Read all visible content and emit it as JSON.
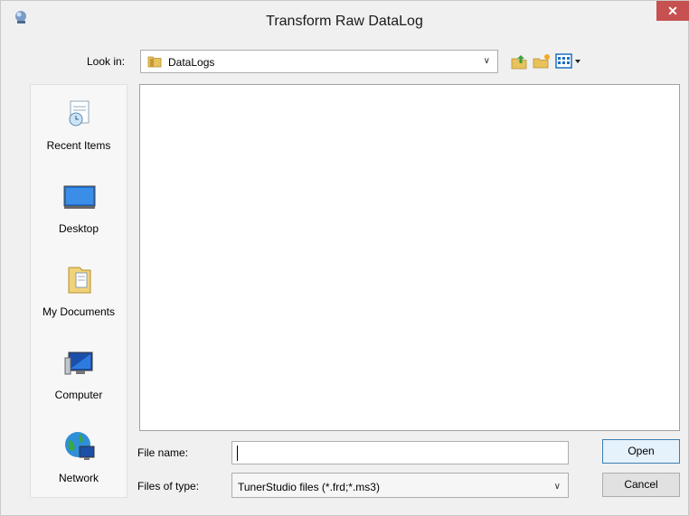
{
  "window": {
    "title": "Transform Raw DataLog",
    "close_glyph": "✕"
  },
  "lookin": {
    "label": "Look in:",
    "value": "DataLogs"
  },
  "toolbar": {
    "icons": [
      "up-folder-icon",
      "new-folder-icon",
      "view-menu-icon"
    ]
  },
  "places": [
    {
      "label": "Recent Items",
      "icon": "recent-items-icon"
    },
    {
      "label": "Desktop",
      "icon": "desktop-icon"
    },
    {
      "label": "My Documents",
      "icon": "my-documents-icon"
    },
    {
      "label": "Computer",
      "icon": "computer-icon"
    },
    {
      "label": "Network",
      "icon": "network-icon"
    }
  ],
  "filename": {
    "label": "File name:",
    "value": ""
  },
  "filetype": {
    "label": "Files of type:",
    "value": "TunerStudio files (*.frd;*.ms3)"
  },
  "buttons": {
    "open": "Open",
    "cancel": "Cancel"
  },
  "colors": {
    "close": "#c75050",
    "accent": "#3c7fb1"
  }
}
